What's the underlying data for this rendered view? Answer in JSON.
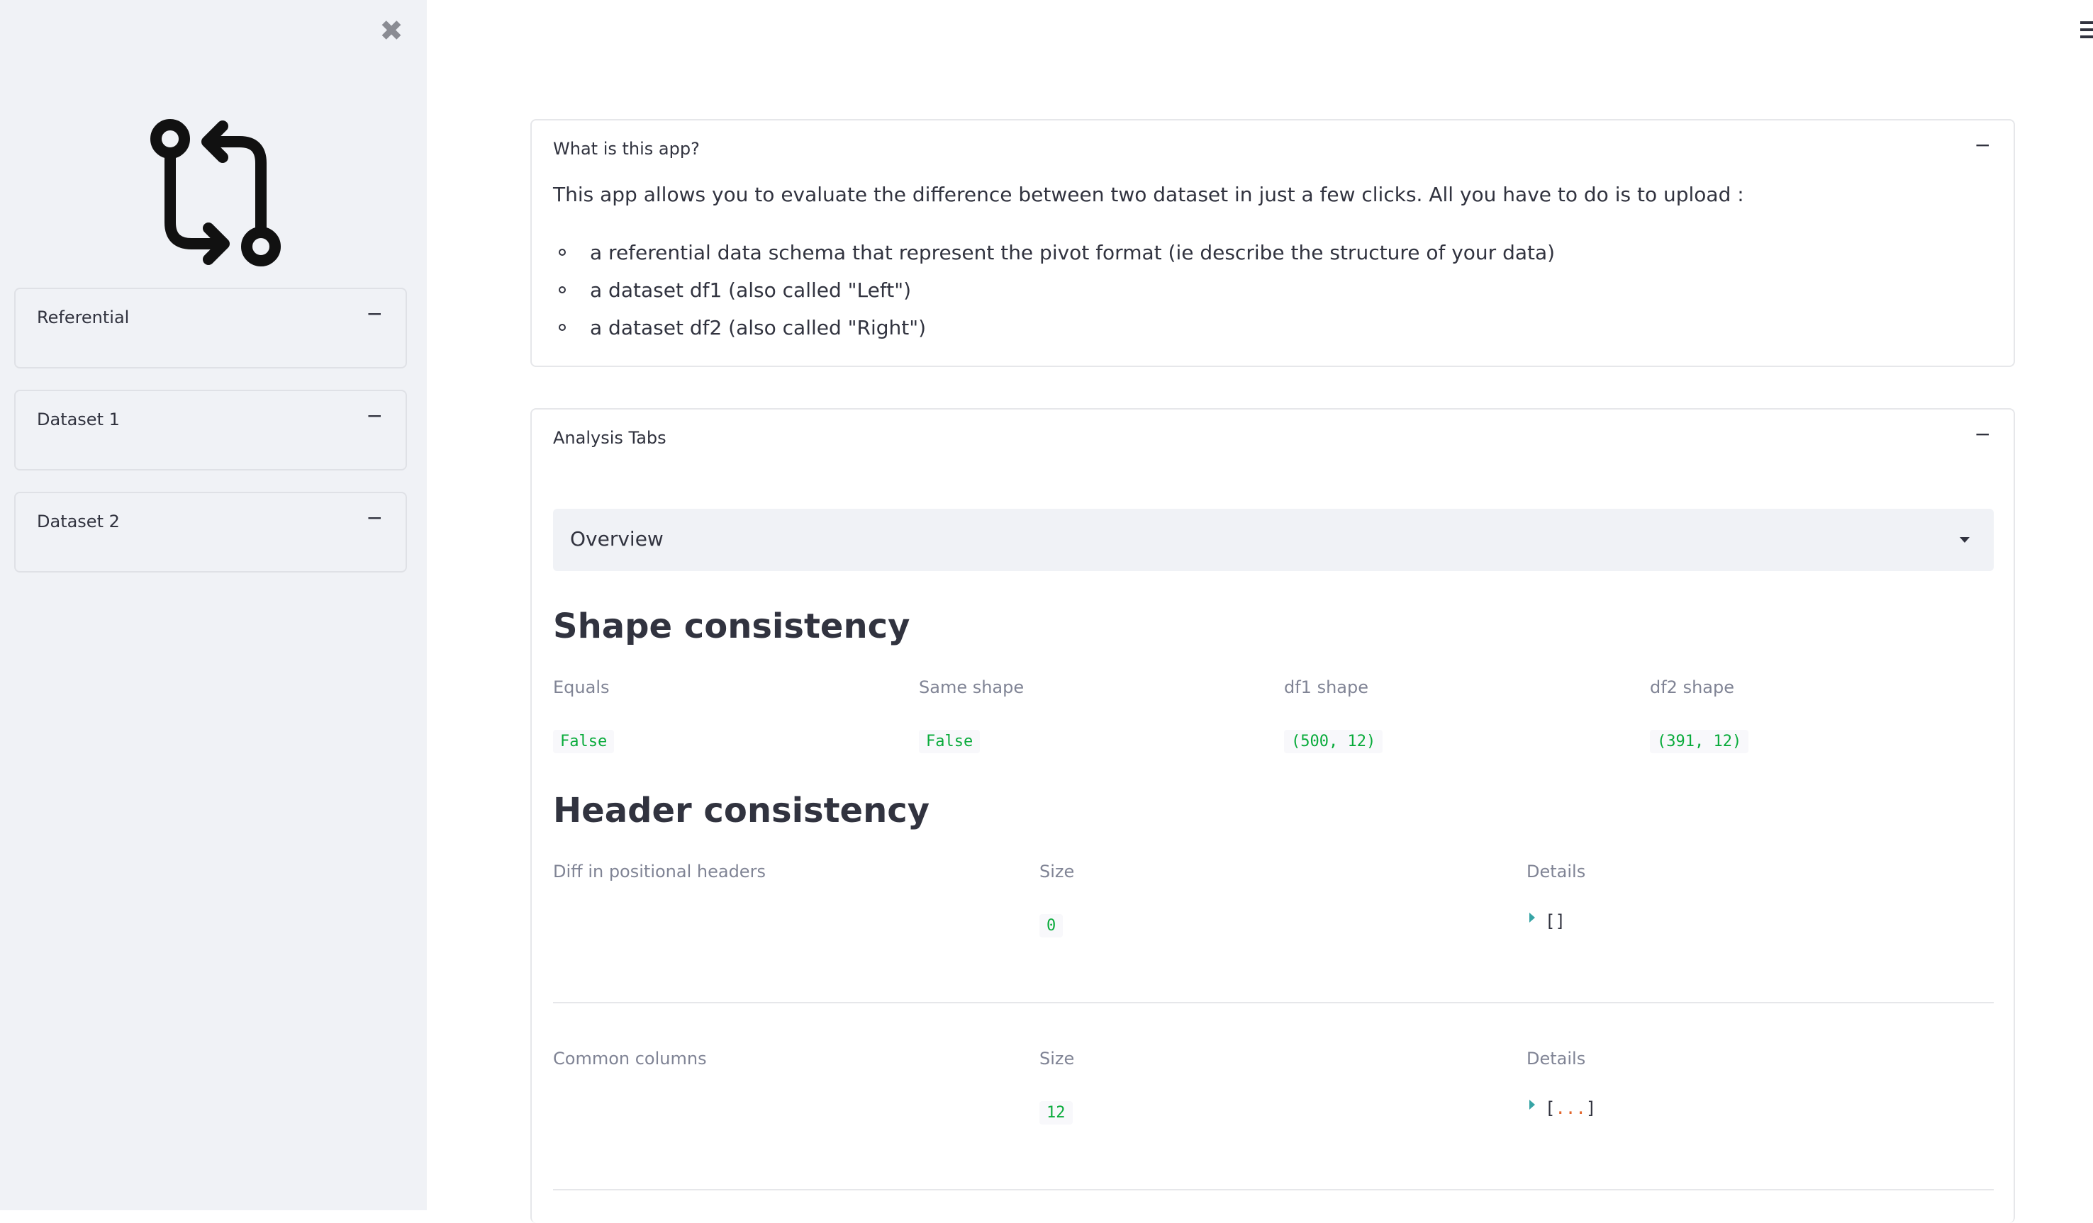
{
  "sidebar": {
    "close_symbol": "✖",
    "logo_icon": "git-compare-icon",
    "expanders": [
      {
        "label": "Referential",
        "toggle": "−"
      },
      {
        "label": "Dataset 1",
        "toggle": "−"
      },
      {
        "label": "Dataset 2",
        "toggle": "−"
      }
    ]
  },
  "header": {
    "menu_icon": "hamburger-menu-icon"
  },
  "about": {
    "title": "What is this app?",
    "toggle": "−",
    "intro": "This app allows you to evaluate the difference between two dataset in just a few clicks. All you have to do is to upload :",
    "bullets": [
      "a referential data schema that represent the pivot format (ie describe the structure of your data)",
      "a dataset df1 (also called \"Left\")",
      "a dataset df2 (also called \"Right\")"
    ]
  },
  "analysis": {
    "title": "Analysis Tabs",
    "toggle": "−",
    "select_value": "Overview",
    "shape": {
      "title": "Shape consistency",
      "metrics": [
        {
          "label": "Equals",
          "value": "False"
        },
        {
          "label": "Same shape",
          "value": "False"
        },
        {
          "label": "df1 shape",
          "value": "(500, 12)"
        },
        {
          "label": "df2 shape",
          "value": "(391, 12)"
        }
      ]
    },
    "header": {
      "title": "Header consistency",
      "rows": [
        {
          "label": "Diff in positional headers",
          "size_label": "Size",
          "size_value": "0",
          "details_label": "Details",
          "details_open": "[",
          "details_ellipsis": "",
          "details_close": "]"
        },
        {
          "label": "Common columns",
          "size_label": "Size",
          "size_value": "12",
          "details_label": "Details",
          "details_open": "[",
          "details_ellipsis": "...",
          "details_close": "]"
        }
      ]
    }
  },
  "colors": {
    "sidebar_bg": "#f0f2f6",
    "code_green": "#09ab3b",
    "tree_arrow": "#36a4a5",
    "ellipsis": "#e2662c"
  }
}
